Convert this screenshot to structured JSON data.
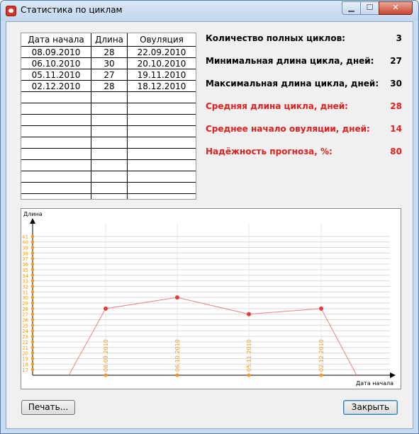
{
  "window": {
    "title": "Статистика по циклам"
  },
  "table": {
    "headers": [
      "Дата начала",
      "Длина",
      "Овуляция"
    ],
    "rows": [
      [
        "08.09.2010",
        "28",
        "22.09.2010"
      ],
      [
        "06.10.2010",
        "30",
        "20.10.2010"
      ],
      [
        "05.11.2010",
        "27",
        "19.11.2010"
      ],
      [
        "02.12.2010",
        "28",
        "18.12.2010"
      ]
    ]
  },
  "stats": [
    {
      "label": "Количество полных циклов:",
      "value": "3",
      "highlight": false
    },
    {
      "label": "Минимальная длина цикла, дней:",
      "value": "27",
      "highlight": false
    },
    {
      "label": "Максимальная длина цикла, дней:",
      "value": "30",
      "highlight": false
    },
    {
      "label": "Средняя длина цикла, дней:",
      "value": "28",
      "highlight": true
    },
    {
      "label": "Среднее начало овуляции, дней:",
      "value": "14",
      "highlight": true
    },
    {
      "label": "Надёжность прогноза, %:",
      "value": "80",
      "highlight": true
    }
  ],
  "chart_data": {
    "type": "line",
    "ylabel": "Длина",
    "xlabel": "Дата начала",
    "y_ticks": [
      17,
      18,
      19,
      20,
      21,
      22,
      23,
      24,
      25,
      26,
      27,
      28,
      29,
      30,
      31,
      32,
      33,
      34,
      35,
      36,
      37,
      38,
      39,
      40,
      41
    ],
    "categories": [
      "08.09.2010",
      "06.10.2010",
      "05.11.2010",
      "02.12.2010"
    ],
    "values": [
      28,
      30,
      27,
      28
    ],
    "ylim": [
      16,
      42
    ],
    "grid": true,
    "line_color": "#f08080",
    "point_color": "#e83c3c",
    "tick_color": "#f39a1e"
  },
  "buttons": {
    "print": "Печать...",
    "close": "Закрыть"
  }
}
